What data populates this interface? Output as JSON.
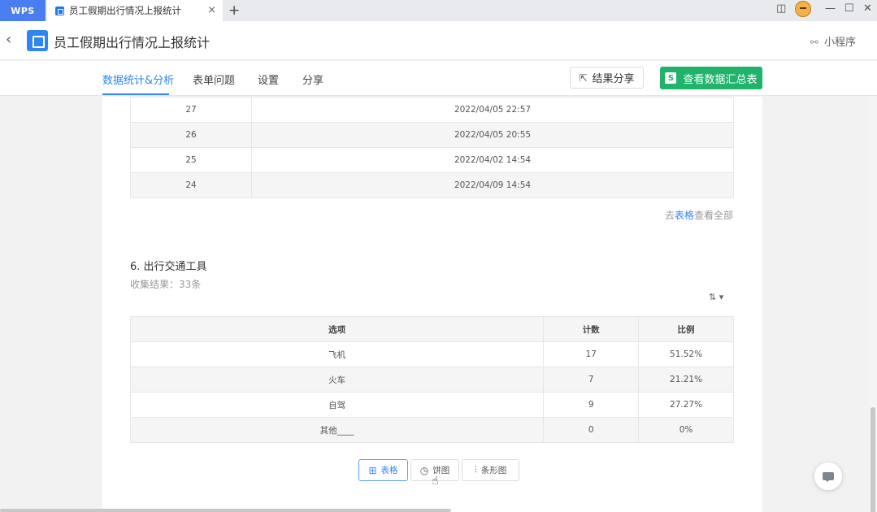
{
  "tabbar": {
    "wps_label": "WPS",
    "doc_tab_title": "员工假期出行情况上报统计",
    "close_glyph": "×",
    "new_tab_glyph": "+",
    "window_controls": {
      "sidebar": "◫",
      "minimize": "—",
      "maximize": "☐",
      "close": "✕"
    }
  },
  "header": {
    "back_glyph": "‹",
    "title": "员工假期出行情况上报统计",
    "mini_program_label": "小程序",
    "link_glyph": "⚯"
  },
  "nav": {
    "tabs": [
      {
        "label": "数据统计&分析",
        "active": true
      },
      {
        "label": "表单问题",
        "active": false
      },
      {
        "label": "设置",
        "active": false
      },
      {
        "label": "分享",
        "active": false
      }
    ],
    "share_button": {
      "icon": "⇱",
      "label": "结果分享"
    },
    "summary_button": {
      "icon": "S",
      "label": "查看数据汇总表"
    }
  },
  "submissions_table": {
    "rows": [
      {
        "id": "27",
        "time": "2022/04/05 22:57"
      },
      {
        "id": "26",
        "time": "2022/04/05 20:55"
      },
      {
        "id": "25",
        "time": "2022/04/02 14:54"
      },
      {
        "id": "24",
        "time": "2022/04/09 14:54"
      }
    ],
    "goto_prefix": "去",
    "goto_link": "表格",
    "goto_suffix": "查看全部"
  },
  "question6": {
    "title": "6.  出行交通工具",
    "collected": "收集结果：33条",
    "sort_glyph": "⇅ ▾",
    "columns": [
      "选项",
      "计数",
      "比例"
    ],
    "rows": [
      {
        "option": "飞机",
        "count": "17",
        "ratio": "51.52%"
      },
      {
        "option": "火车",
        "count": "7",
        "ratio": "21.21%"
      },
      {
        "option": "自驾",
        "count": "9",
        "ratio": "27.27%"
      },
      {
        "option": "其他____",
        "count": "0",
        "ratio": "0%"
      }
    ],
    "views": [
      {
        "icon": "⊞",
        "label": "表格",
        "active": true
      },
      {
        "icon": "◷",
        "label": "饼图",
        "active": false
      },
      {
        "icon": "⫶",
        "label": "条形图",
        "active": false
      }
    ]
  },
  "colors": {
    "accent": "#2f86f3",
    "green": "#21b36a",
    "wps_blue": "#4a7ef0"
  },
  "cursor_glyph": "☝"
}
